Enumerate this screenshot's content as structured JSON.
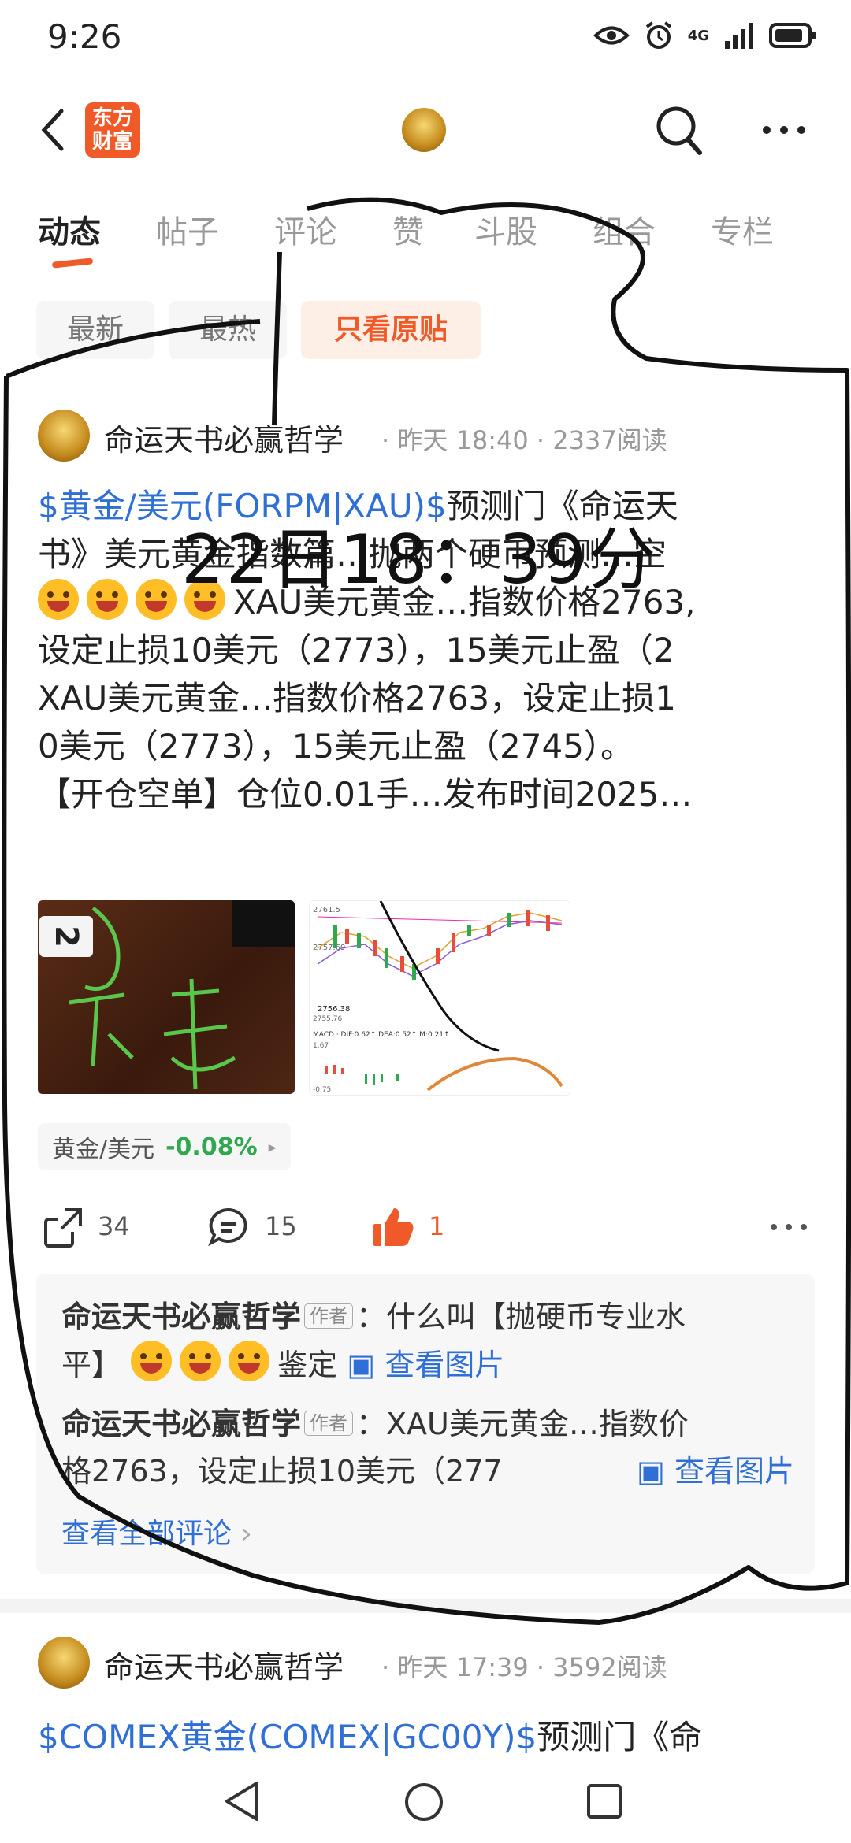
{
  "status_bar": {
    "time": "9:26",
    "network": "4G"
  },
  "header": {
    "logo_text": "东方\n财富",
    "icons": [
      "back-arrow",
      "avatar",
      "search-icon",
      "more-icon"
    ]
  },
  "tabs": [
    "动态",
    "帖子",
    "评论",
    "赞",
    "斗股",
    "组合",
    "专栏"
  ],
  "filters": [
    "最新",
    "最热",
    "只看原贴"
  ],
  "post1": {
    "author": "命运天书必赢哲学",
    "time": "昨天 18:40",
    "reads": "2337阅读",
    "tag": "$黄金/美元(FORPM|XAU)$",
    "line1_rest": "预测门《命运天",
    "line2": "书》美元黄金指数篇…抛两个硬币预测…空",
    "line3_rest": "XAU美元黄金…指数价格2763,",
    "line4": "设定止损10美元（2773），15美元止盈（2",
    "line5": "XAU美元黄金…指数价格2763，设定止损1",
    "line6": "0美元（2773），15美元止盈（2745）。",
    "line7": "【开仓空单】仓位0.01手…发布时间2025…",
    "stock_name": "黄金/美元",
    "stock_change": "-0.08%",
    "share_count": "34",
    "comment_count": "15",
    "like_count": "1",
    "chart_labels": {
      "top": "2761.5",
      "mid1": "2757.69",
      "mid2": "2756.38",
      "mid3": "2755.76",
      "macd": "MACD · DIF:0.62↑  DEA:0.52↑  M:0.21↑",
      "macd_top": "1.67",
      "macd_bottom": "-0.75"
    },
    "img1_label": "2"
  },
  "comments": {
    "c1_author": "命运天书必赢哲学",
    "c1_tag": "作者",
    "c1_text_a": "：什么叫【抛硬币专业水",
    "c1_text_b": "平】",
    "c1_text_c": "鉴定",
    "c1_link": "查看图片",
    "c2_author": "命运天书必赢哲学",
    "c2_tag": "作者",
    "c2_text_a": "：XAU美元黄金…指数价",
    "c2_text_b": "格2763，设定止损10美元（277",
    "c2_link": "查看图片",
    "view_all": "查看全部评论"
  },
  "post2": {
    "author": "命运天书必赢哲学",
    "time": "昨天 17:39",
    "reads": "3592阅读",
    "tag": "$COMEX黄金(COMEX|GC00Y)$",
    "line1_rest": "预测门《命"
  },
  "overlay_text": "22日18：39分"
}
